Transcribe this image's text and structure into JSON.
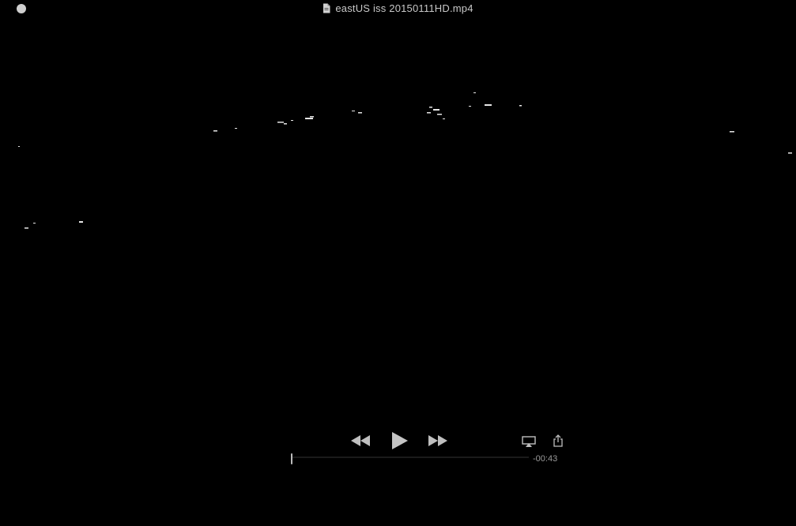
{
  "window": {
    "title": "eastUS iss 20150111HD.mp4"
  },
  "icons": {
    "close": "close-dot",
    "document": "document-icon",
    "rewind": "rewind-icon",
    "play": "play-icon",
    "fast_forward": "fast-forward-icon",
    "airplay": "airplay-icon",
    "share": "share-icon"
  },
  "playback": {
    "time_remaining": "-00:43",
    "progress": 0.0
  },
  "colors": {
    "background": "#000000",
    "controls": "#bfbfbf",
    "title_text": "#c8c8c8"
  }
}
